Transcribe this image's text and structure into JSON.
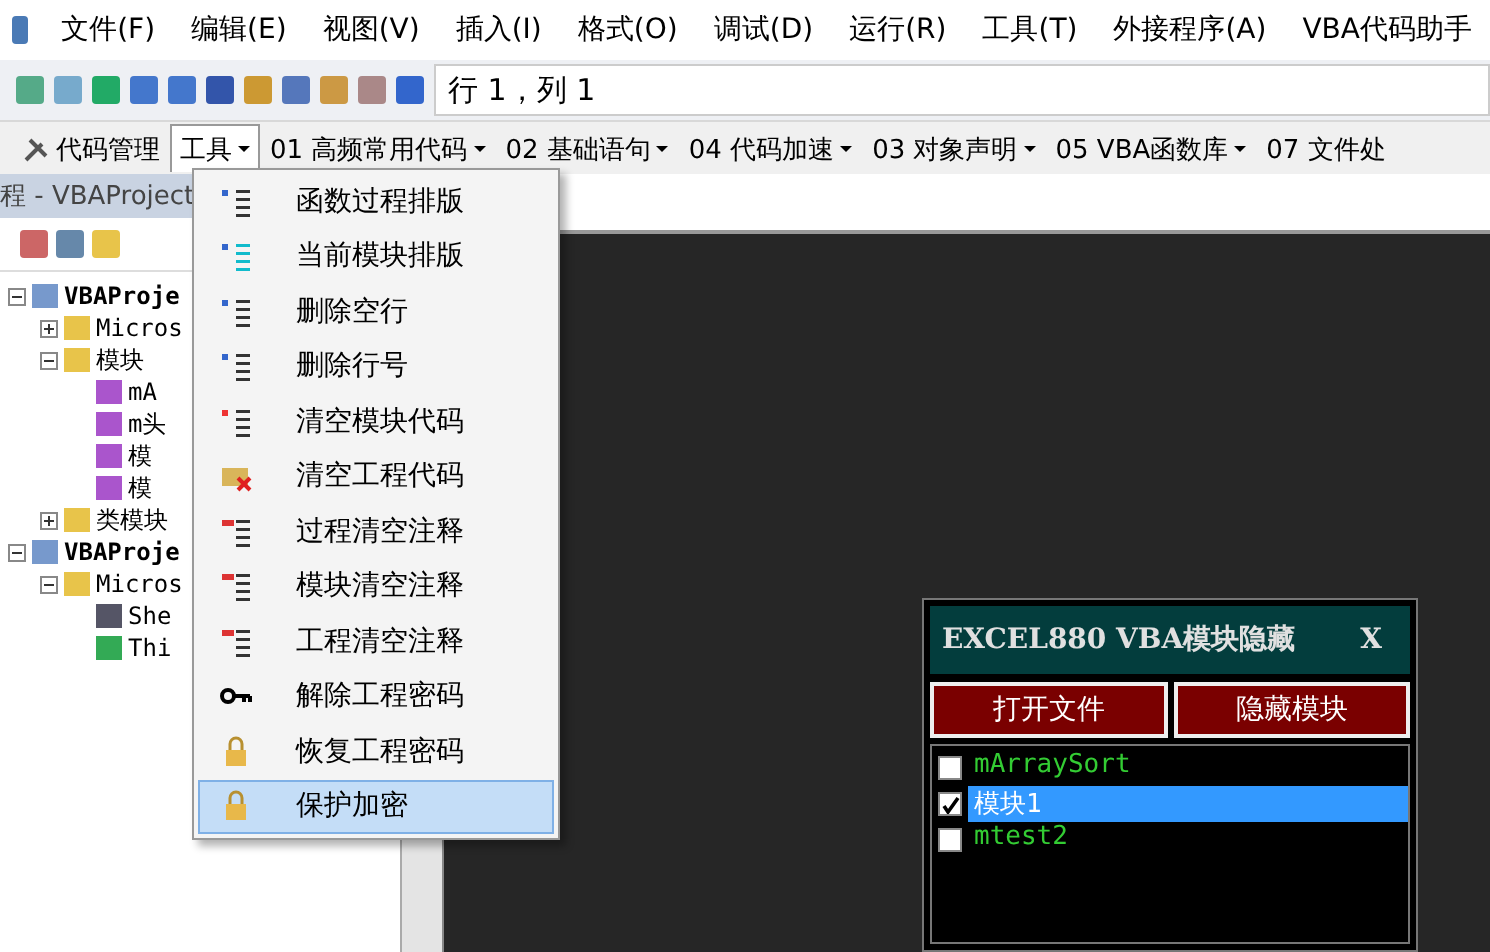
{
  "menu_bar": [
    "文件(F)",
    "编辑(E)",
    "视图(V)",
    "插入(I)",
    "格式(O)",
    "调试(D)",
    "运行(R)",
    "工具(T)",
    "外接程序(A)",
    "VBA代码助手"
  ],
  "toolbar": {
    "position": "行 1，列 1"
  },
  "addin_toolbar": [
    {
      "label": "代码管理",
      "dropdown": false,
      "selected": false
    },
    {
      "label": "工具",
      "dropdown": true,
      "selected": true
    },
    {
      "label": "01 高频常用代码",
      "dropdown": true,
      "selected": false
    },
    {
      "label": "02 基础语句",
      "dropdown": true,
      "selected": false
    },
    {
      "label": "04 代码加速",
      "dropdown": true,
      "selected": false
    },
    {
      "label": "03 对象声明",
      "dropdown": true,
      "selected": false
    },
    {
      "label": "05 VBA函数库",
      "dropdown": true,
      "selected": false
    },
    {
      "label": "07 文件处",
      "dropdown": false,
      "selected": false
    }
  ],
  "project_panel": {
    "title": "程 - VBAProject",
    "tree": [
      {
        "label": "VBAProje",
        "kind": "project",
        "expanded": true,
        "children": [
          {
            "label": "Micros",
            "kind": "folder",
            "expanded": false
          },
          {
            "label": "模块",
            "kind": "folder",
            "expanded": true,
            "children": [
              {
                "label": "mA",
                "kind": "module"
              },
              {
                "label": "m头",
                "kind": "module"
              },
              {
                "label": "模",
                "kind": "module"
              },
              {
                "label": "模",
                "kind": "module"
              }
            ]
          },
          {
            "label": "类模块",
            "kind": "folder",
            "expanded": false
          }
        ]
      },
      {
        "label": "VBAProje",
        "kind": "project",
        "expanded": true,
        "children": [
          {
            "label": "Micros",
            "kind": "folder",
            "expanded": true,
            "children": [
              {
                "label": "She",
                "kind": "sheet"
              },
              {
                "label": "Thi",
                "kind": "workbook"
              }
            ]
          }
        ]
      }
    ]
  },
  "tools_menu": [
    {
      "label": "函数过程排版",
      "selected": false
    },
    {
      "label": "当前模块排版",
      "selected": false
    },
    {
      "label": "删除空行",
      "selected": false
    },
    {
      "label": "删除行号",
      "selected": false
    },
    {
      "label": "清空模块代码",
      "selected": false
    },
    {
      "label": "清空工程代码",
      "selected": false
    },
    {
      "label": "过程清空注释",
      "selected": false
    },
    {
      "label": "模块清空注释",
      "selected": false
    },
    {
      "label": "工程清空注释",
      "selected": false
    },
    {
      "label": "解除工程密码",
      "selected": false
    },
    {
      "label": "恢复工程密码",
      "selected": false
    },
    {
      "label": "保护加密",
      "selected": true
    }
  ],
  "dialog": {
    "title": "EXCEL880 VBA模块隐藏",
    "close": "X",
    "buttons": [
      "打开文件",
      "隐藏模块"
    ],
    "modules": [
      {
        "label": "mArraySort",
        "checked": false,
        "selected": false
      },
      {
        "label": "模块1",
        "checked": true,
        "selected": true
      },
      {
        "label": "mtest2",
        "checked": false,
        "selected": false
      }
    ]
  }
}
